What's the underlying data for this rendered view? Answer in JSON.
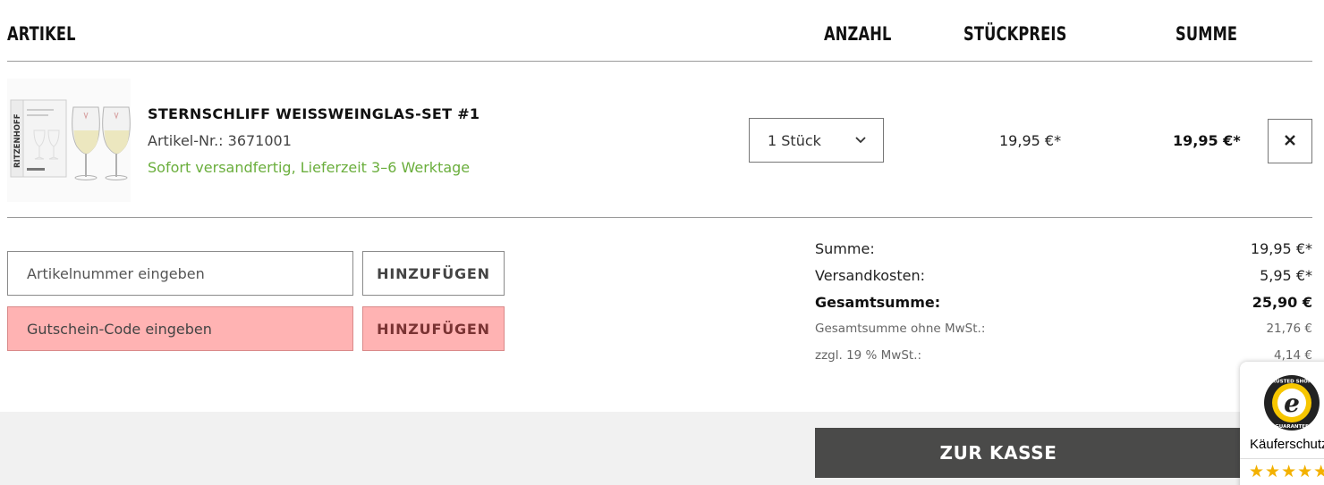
{
  "table_header": {
    "artikel": "ARTIKEL",
    "anzahl": "ANZAHL",
    "stueckpreis": "STÜCKPREIS",
    "summe": "SUMME"
  },
  "item": {
    "image_icon": "wine-glass-set-product-image",
    "brand_on_box": "RITZENHOFF",
    "name": "STERNSCHLIFF WEISSWEINGLAS-SET #1",
    "sku": "Artikel-Nr.: 3671001",
    "shipping": "Sofort versandfertig, Lieferzeit 3–6 Werktage",
    "shipping_color": "#6aae3c",
    "quantity": "1 Stück",
    "unit_price": "19,95 €*",
    "row_total": "19,95 €*",
    "remove_icon": "close-icon"
  },
  "forms": {
    "article_placeholder": "Artikelnummer eingeben",
    "article_button": "HINZUFÜGEN",
    "voucher_placeholder": "Gutschein-Code eingeben",
    "voucher_button": "HINZUFÜGEN",
    "highlight_color": "#ffb3b3"
  },
  "summary": {
    "summe_label": "Summe:",
    "summe_value": "19,95 €*",
    "versand_label": "Versandkosten:",
    "versand_value": "5,95 €*",
    "gesamt_label": "Gesamtsumme:",
    "gesamt_value": "25,90 €",
    "netto_label": "Gesamtsumme ohne MwSt.:",
    "netto_value": "21,76 €",
    "mwst_label": "zzgl. 19 % MwSt.:",
    "mwst_value": "4,14 €"
  },
  "checkout_button": "ZUR KASSE",
  "checkout_color": "#4a4a49",
  "trusted_shops": {
    "seal_icon": "trusted-shops-seal-icon",
    "seal_top_text": "TRUSTED SHOPS",
    "seal_bottom_text": "GUARANTEE",
    "label": "Käuferschutz",
    "stars": "★★★★★"
  }
}
